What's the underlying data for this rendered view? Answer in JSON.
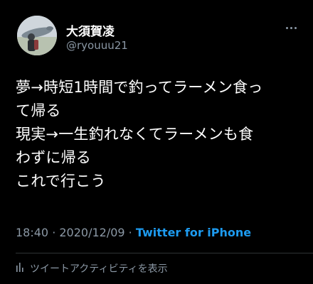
{
  "tweet": {
    "display_name": "大須賀凌",
    "handle": "@ryouuu21",
    "text_lines": [
      "夢→時短1時間で釣ってラーメン食っ",
      "て帰る",
      "現実→一生釣れなくてラーメンも食",
      "わずに帰る",
      "これで行こう"
    ],
    "timestamp": "18:40 · 2020/12/09 · ",
    "source": "Twitter for iPhone",
    "activity_label": "ツイートアクティビティを表示"
  },
  "icons": {
    "more": "more-horizontal-icon",
    "activity": "bar-chart-icon",
    "avatar": "profile-photo"
  },
  "colors": {
    "background": "#000000",
    "primary_text": "#ffffff",
    "secondary_text": "#8b98a5",
    "link": "#1d9bf0",
    "divider": "#2f3336"
  }
}
